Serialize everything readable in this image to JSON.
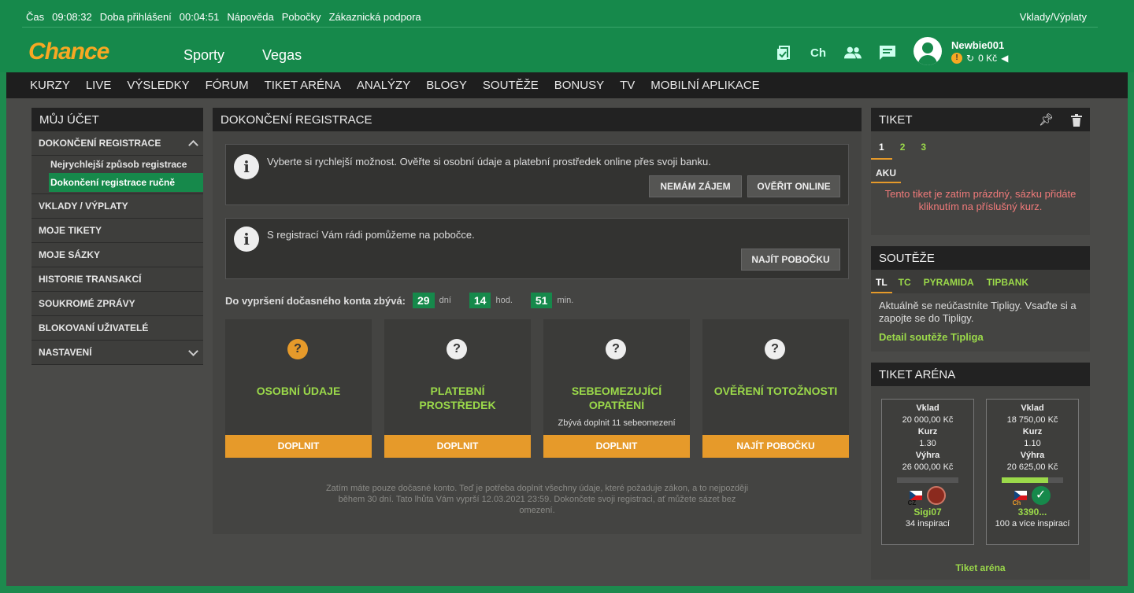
{
  "topbar": {
    "cas_label": "Čas",
    "time": "09:08:32",
    "login_label": "Doba přihlášení",
    "login_time": "00:04:51",
    "help": "Nápověda",
    "branches": "Pobočky",
    "support": "Zákaznická podpora",
    "deposits": "Vklady/Výplaty"
  },
  "header": {
    "logo": "Chance",
    "nav": [
      "Sporty",
      "Vegas"
    ],
    "icons": [
      "ticket-icon",
      "chance-icon",
      "users-icon",
      "chat-icon"
    ],
    "ch_text": "Ch",
    "username": "Newbie001",
    "balance": "0 Kč"
  },
  "navbar": [
    "KURZY",
    "LIVE",
    "VÝSLEDKY",
    "FÓRUM",
    "TIKET ARÉNA",
    "ANALÝZY",
    "BLOGY",
    "SOUTĚŽE",
    "BONUSY",
    "TV",
    "MOBILNÍ APLIKACE"
  ],
  "account_menu": {
    "title": "MŮJ ÚČET",
    "section": "DOKONČENÍ REGISTRACE",
    "subitems": [
      "Nejrychlejší způsob registrace",
      "Dokončení registrace ručně"
    ],
    "items": [
      "VKLADY / VÝPLATY",
      "MOJE TIKETY",
      "MOJE SÁZKY",
      "HISTORIE TRANSAKCÍ",
      "SOUKROMÉ ZPRÁVY",
      "BLOKOVANÍ UŽIVATELÉ",
      "NASTAVENÍ"
    ]
  },
  "registration": {
    "title": "DOKONČENÍ REGISTRACE",
    "info1": "Vyberte si rychlejší možnost. Ověřte si osobní údaje a platební prostředek online přes svoji banku.",
    "btn_no": "NEMÁM ZÁJEM",
    "btn_verify": "OVĚŘIT ONLINE",
    "info2": "S registrací Vám rádi pomůžeme na pobočce.",
    "btn_branch": "NAJÍT POBOČKU",
    "countdown_label": "Do vypršení dočasného konta zbývá:",
    "days": "29",
    "days_unit": "dní",
    "hours": "14",
    "hours_unit": "hod.",
    "mins": "51",
    "mins_unit": "min.",
    "cards": [
      {
        "title1": "OSOBNÍ ÚDAJE",
        "title2": "",
        "note": "",
        "button": "DOPLNIT"
      },
      {
        "title1": "PLATEBNÍ",
        "title2": "PROSTŘEDEK",
        "note": "",
        "button": "DOPLNIT"
      },
      {
        "title1": "SEBEOMEZUJÍCÍ",
        "title2": "OPATŘENÍ",
        "note": "Zbývá doplnit 11 sebeomezení",
        "button": "DOPLNIT"
      },
      {
        "title1": "OVĚŘENÍ TOTOŽNOSTI",
        "title2": "",
        "note": "",
        "button": "NAJÍT POBOČKU"
      }
    ],
    "footnote": "Zatím máte pouze dočasné konto. Teď je potřeba doplnit všechny údaje, které požaduje zákon, a to nejpozději během 30 dní. Tato lhůta Vám vyprší 12.03.2021 23:59. Dokončete svoji registraci, ať můžete sázet bez omezení."
  },
  "ticket": {
    "title": "TIKET",
    "tabs": [
      "1",
      "2",
      "3"
    ],
    "aku": "AKU",
    "empty": "Tento tiket je zatím prázdný, sázku přidáte kliknutím na příslušný kurz."
  },
  "contests": {
    "title": "SOUTĚŽE",
    "tabs": [
      "TL",
      "TC",
      "PYRAMIDA",
      "TIPBANK"
    ],
    "text": "Aktuálně se neúčastníte Tipligy. Vsaďte si a zapojte se do Tipligy.",
    "link": "Detail soutěže Tipliga"
  },
  "arena": {
    "title": "TIKET ARÉNA",
    "label_vklad": "Vklad",
    "label_kurz": "Kurz",
    "label_vyhra": "Výhra",
    "entries": [
      {
        "vklad": "20 000,00 Kč",
        "kurz": "1.30",
        "vyhra": "26 000,00 Kč",
        "progress": 0,
        "country": "CZ",
        "name": "Sigi07",
        "inspirations": "34 inspirací"
      },
      {
        "vklad": "18 750,00 Kč",
        "kurz": "1.10",
        "vyhra": "20 625,00 Kč",
        "progress": 0.75,
        "country": "Ch",
        "name": "3390...",
        "inspirations": "100 a více inspirací"
      }
    ],
    "link": "Tiket aréna"
  },
  "colors": {
    "green": "#16894b",
    "orange": "#e69a2a",
    "lime": "#9bd94a",
    "logo": "#f7a823"
  }
}
